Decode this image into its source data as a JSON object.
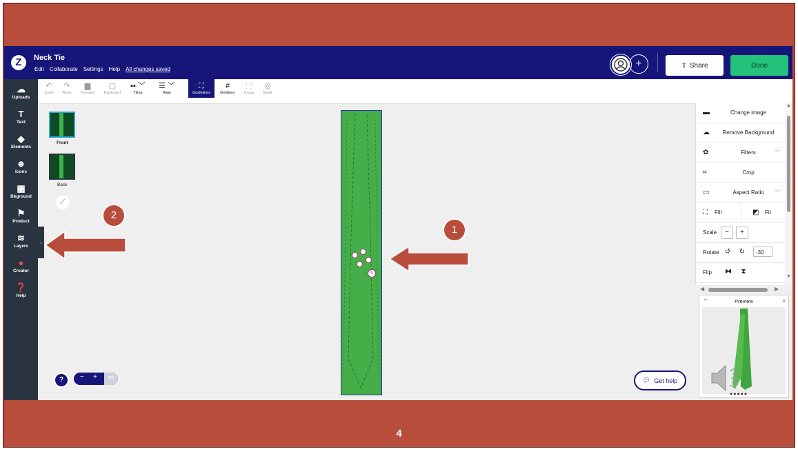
{
  "header": {
    "logo": "Z",
    "title": "Neck Tie",
    "menu": [
      "Edit",
      "Collaborate",
      "Settings",
      "Help"
    ],
    "saved_status": "All changes saved",
    "share_label": "Share",
    "done_label": "Done"
  },
  "sidebar": {
    "items": [
      {
        "label": "Uploads",
        "icon": "upload-cloud-icon"
      },
      {
        "label": "Text",
        "icon": "text-icon"
      },
      {
        "label": "Elements",
        "icon": "elements-icon"
      },
      {
        "label": "Icons",
        "icon": "smiley-icon"
      },
      {
        "label": "Bkground",
        "icon": "background-icon"
      },
      {
        "label": "Product",
        "icon": "product-icon"
      },
      {
        "label": "Layers",
        "icon": "layers-icon"
      },
      {
        "label": "Creator",
        "icon": "creator-avatar-icon"
      },
      {
        "label": "Help",
        "icon": "help-icon"
      }
    ]
  },
  "toolbar": {
    "undo": "Undo",
    "redo": "Redo",
    "forward": "Forward",
    "backward": "Backward",
    "tiling": "Tiling",
    "align": "Align",
    "guidelines": "Guidelines",
    "gridlines": "Gridlines",
    "group": "Group",
    "mask": "Mask"
  },
  "pages": [
    {
      "label": "Front"
    },
    {
      "label": "Back"
    }
  ],
  "zoom": {
    "minus": "−",
    "plus": "+",
    "fit": "Fit"
  },
  "help_fab": "?",
  "get_help": "Get help",
  "panel": {
    "change_image": "Change image",
    "remove_background": "Remove Background",
    "filters": "Filters",
    "crop": "Crop",
    "aspect_ratio": "Aspect Ratio",
    "fill": "Fill",
    "fit": "Fit",
    "scale": "Scale",
    "rotate": "Rotate",
    "rotate_value": "-30",
    "flip": "Flip"
  },
  "preview": {
    "title": "Preview",
    "collapse": "−"
  },
  "annotations": {
    "badge1": "1",
    "badge2": "2"
  },
  "page_number": "4",
  "colors": {
    "slide_bg": "#b84d3c",
    "header": "#16157a",
    "sidebar": "#2a3340",
    "done": "#22c27d",
    "tie_green": "#47b14a"
  }
}
